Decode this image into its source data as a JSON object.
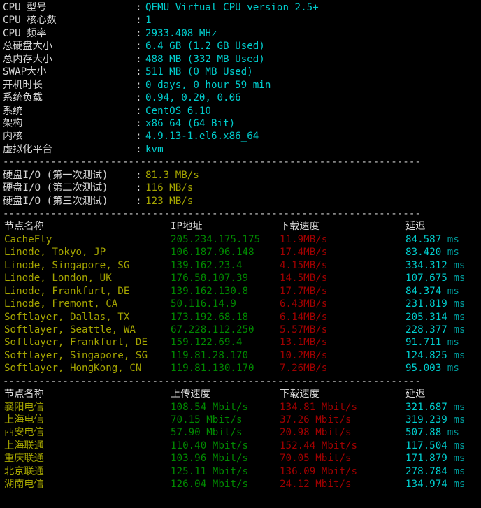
{
  "terminal": {
    "separator": "----------------------------------------------------------------------"
  },
  "system_info": {
    "rows": [
      {
        "label": "CPU 型号",
        "colon": ":",
        "value": "QEMU Virtual CPU version 2.5+"
      },
      {
        "label": "CPU 核心数",
        "colon": ":",
        "value": "1"
      },
      {
        "label": "CPU 频率",
        "colon": ":",
        "value": "2933.408 MHz"
      },
      {
        "label": "总硬盘大小",
        "colon": ":",
        "value": "6.4 GB (1.2 GB Used)"
      },
      {
        "label": "总内存大小",
        "colon": ":",
        "value": "488 MB (332 MB Used)"
      },
      {
        "label": "SWAP大小",
        "colon": ":",
        "value": "511 MB (0 MB Used)"
      },
      {
        "label": "开机时长",
        "colon": ":",
        "value": "0 days, 0 hour 59 min"
      },
      {
        "label": "系统负载",
        "colon": ":",
        "value": "0.94, 0.20, 0.06"
      },
      {
        "label": "系统",
        "colon": ":",
        "value": "CentOS 6.10"
      },
      {
        "label": "架构",
        "colon": ":",
        "value": "x86_64 (64 Bit)"
      },
      {
        "label": "内核",
        "colon": ":",
        "value": "4.9.13-1.el6.x86_64"
      },
      {
        "label": "虚拟化平台",
        "colon": ":",
        "value": "kvm"
      }
    ]
  },
  "disk_io": {
    "rows": [
      {
        "label": "硬盘I/O (第一次测试)",
        "colon": ":",
        "value": "81.3 MB/s"
      },
      {
        "label": "硬盘I/O (第二次测试)",
        "colon": ":",
        "value": "116 MB/s"
      },
      {
        "label": "硬盘I/O (第三次测试)",
        "colon": ":",
        "value": "123 MB/s"
      }
    ]
  },
  "international_nodes": {
    "headers": {
      "name": "节点名称",
      "ip": "IP地址",
      "download": "下载速度",
      "latency": "延迟"
    },
    "rows": [
      {
        "name": "CacheFly",
        "ip": "205.234.175.175",
        "download": "11.9MB/s",
        "latency": "84.587",
        "unit": "ms"
      },
      {
        "name": "Linode, Tokyo, JP",
        "ip": "106.187.96.148",
        "download": "17.4MB/s",
        "latency": "83.420",
        "unit": "ms"
      },
      {
        "name": "Linode, Singapore, SG",
        "ip": "139.162.23.4",
        "download": "4.15MB/s",
        "latency": "334.312",
        "unit": "ms"
      },
      {
        "name": "Linode, London, UK",
        "ip": "176.58.107.39",
        "download": "14.5MB/s",
        "latency": "107.675",
        "unit": "ms"
      },
      {
        "name": "Linode, Frankfurt, DE",
        "ip": "139.162.130.8",
        "download": "17.7MB/s",
        "latency": "84.374",
        "unit": "ms"
      },
      {
        "name": "Linode, Fremont, CA",
        "ip": "50.116.14.9",
        "download": "6.43MB/s",
        "latency": "231.819",
        "unit": "ms"
      },
      {
        "name": "Softlayer, Dallas, TX",
        "ip": "173.192.68.18",
        "download": "6.14MB/s",
        "latency": "205.314",
        "unit": "ms"
      },
      {
        "name": "Softlayer, Seattle, WA",
        "ip": "67.228.112.250",
        "download": "5.57MB/s",
        "latency": "228.377",
        "unit": "ms"
      },
      {
        "name": "Softlayer, Frankfurt, DE",
        "ip": "159.122.69.4",
        "download": "13.1MB/s",
        "latency": "91.711",
        "unit": "ms"
      },
      {
        "name": "Softlayer, Singapore, SG",
        "ip": "119.81.28.170",
        "download": "10.2MB/s",
        "latency": "124.825",
        "unit": "ms"
      },
      {
        "name": "Softlayer, HongKong, CN",
        "ip": "119.81.130.170",
        "download": "7.26MB/s",
        "latency": "95.003",
        "unit": "ms"
      }
    ]
  },
  "china_nodes": {
    "headers": {
      "name": "节点名称",
      "upload": "上传速度",
      "download": "下载速度",
      "latency": "延迟"
    },
    "rows": [
      {
        "name": "襄阳电信",
        "upload": "108.54 Mbit/s",
        "download": "134.81 Mbit/s",
        "latency": "321.687",
        "unit": "ms"
      },
      {
        "name": "上海电信",
        "upload": "70.15 Mbit/s",
        "download": "37.26 Mbit/s",
        "latency": "319.239",
        "unit": "ms"
      },
      {
        "name": "西安电信",
        "upload": "57.90 Mbit/s",
        "download": "20.98 Mbit/s",
        "latency": "507.88",
        "unit": "ms"
      },
      {
        "name": "上海联通",
        "upload": "110.40 Mbit/s",
        "download": "152.44 Mbit/s",
        "latency": "117.504",
        "unit": "ms"
      },
      {
        "name": "重庆联通",
        "upload": "103.96 Mbit/s",
        "download": "70.05 Mbit/s",
        "latency": "171.879",
        "unit": "ms"
      },
      {
        "name": "北京联通",
        "upload": "125.11 Mbit/s",
        "download": "136.09 Mbit/s",
        "latency": "278.784",
        "unit": "ms"
      },
      {
        "name": "湖南电信",
        "upload": "126.04 Mbit/s",
        "download": "24.12 Mbit/s",
        "latency": "134.974",
        "unit": "ms"
      }
    ]
  },
  "colors": {
    "background": "#000000",
    "label": "#d8d8d8",
    "cyan": "#00cdcd",
    "yellow": "#a5a500",
    "green": "#008a00",
    "red": "#a00000"
  }
}
